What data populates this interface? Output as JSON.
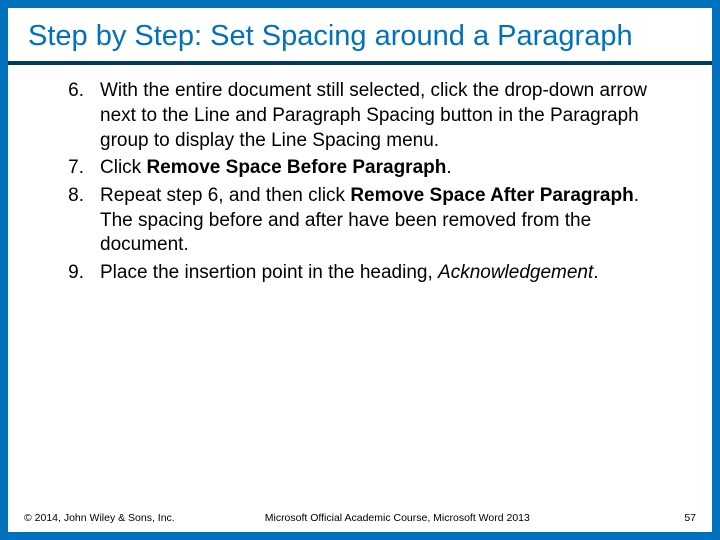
{
  "title": "Step by Step: Set Spacing around a Paragraph",
  "steps": [
    {
      "num": "6.",
      "segments": [
        {
          "t": "With the entire document still selected, click the drop-down arrow next to the Line and Paragraph Spacing button in the Paragraph group to display the Line Spacing menu."
        }
      ]
    },
    {
      "num": "7.",
      "segments": [
        {
          "t": "Click "
        },
        {
          "t": "Remove Space Before Paragraph",
          "b": true
        },
        {
          "t": "."
        }
      ]
    },
    {
      "num": "8.",
      "segments": [
        {
          "t": "Repeat step 6, and then click "
        },
        {
          "t": "Remove Space After Paragraph",
          "b": true
        },
        {
          "t": ". The spacing before and after have been removed from the document."
        }
      ]
    },
    {
      "num": "9.",
      "segments": [
        {
          "t": "Place the insertion point in the heading, "
        },
        {
          "t": "Acknowledgement",
          "i": true
        },
        {
          "t": "."
        }
      ]
    }
  ],
  "footer": {
    "copyright": "© 2014, John Wiley & Sons, Inc.",
    "course": "Microsoft Official Academic Course, Microsoft Word 2013",
    "page": "57"
  }
}
